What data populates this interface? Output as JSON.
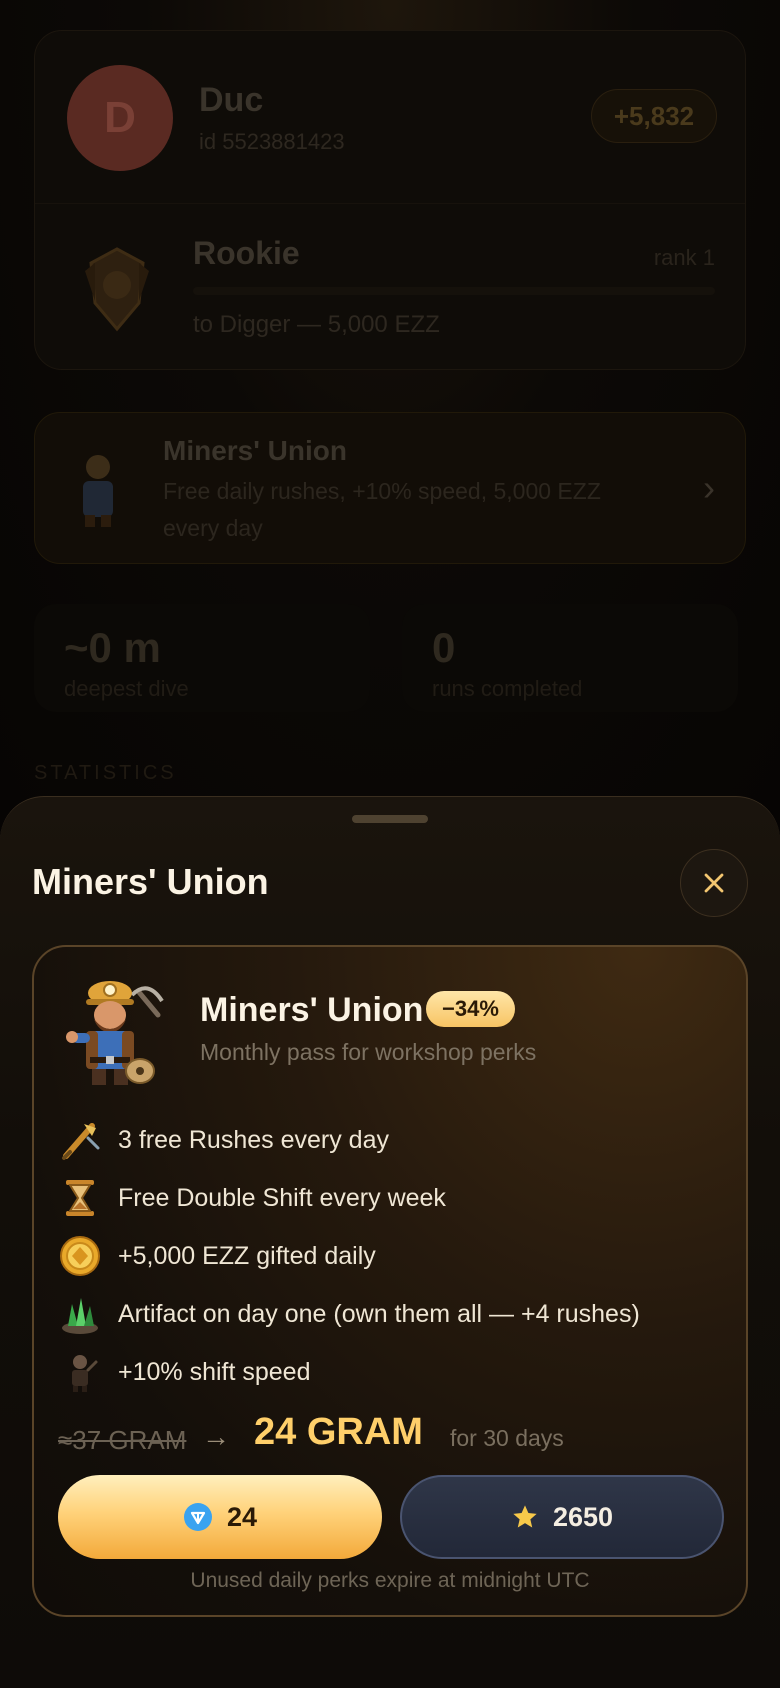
{
  "background": {
    "profile": {
      "avatar_letter": "D",
      "name": "Duc",
      "user_id": "id 5523881423",
      "balance": "+5,832"
    },
    "rank": {
      "name": "Rookie",
      "level": "rank 1",
      "next": "to Digger — 5,000 EZZ"
    },
    "union_card": {
      "title": "Miners' Union",
      "description": "Free daily rushes, +10% speed, 5,000 EZZ every day"
    },
    "stats": [
      {
        "value": "~0 m",
        "label": "deepest dive"
      },
      {
        "value": "0",
        "label": "runs completed"
      }
    ],
    "section_label": "STATISTICS"
  },
  "sheet": {
    "title": "Miners' Union",
    "offer": {
      "title": "Miners' Union",
      "discount": "−34%",
      "subtitle": "Monthly pass for workshop perks",
      "perks": [
        {
          "icon": "pickaxe-drill-icon",
          "label": "3 free Rushes every day"
        },
        {
          "icon": "hourglass-icon",
          "label": "Free Double Shift every week"
        },
        {
          "icon": "gold-coin-icon",
          "label": "+5,000 EZZ gifted daily"
        },
        {
          "icon": "green-crystal-icon",
          "label": "Artifact on day one (own them all — +4 rushes)"
        },
        {
          "icon": "miner-figure-icon",
          "label": "+10% shift speed"
        }
      ],
      "old_price": "≈37 GRAM",
      "arrow": "→",
      "new_price": "24 GRAM",
      "period": "for 30 days",
      "ton_price": "24",
      "stars_price": "2650",
      "footnote": "Unused daily perks expire at midnight UTC"
    }
  },
  "colors": {
    "accent_gold": "#ffcf6a",
    "badge_gold": "#f7c464",
    "stars_button": "#2f3648",
    "ton_blue": "#3aa3f0"
  }
}
